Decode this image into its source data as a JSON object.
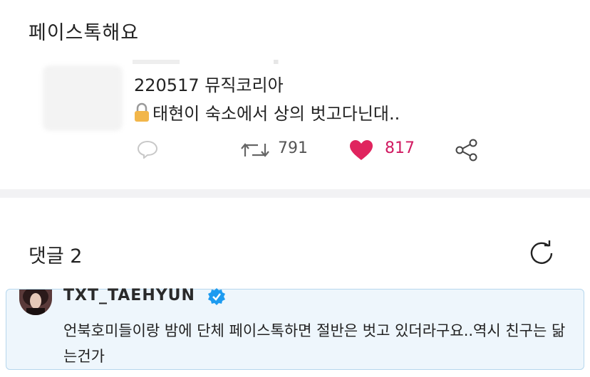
{
  "header": {
    "title": "페이스톡해요"
  },
  "tweet": {
    "line1": "220517 뮤직코리아",
    "line2": "태현이 숙소에서 상의 벗고다닌대..",
    "icons": {
      "lock": "lock-icon",
      "reply": "reply-icon",
      "retweet": "retweet-icon",
      "like": "heart-icon",
      "share": "share-icon"
    },
    "retweets": "791",
    "likes": "817",
    "colors": {
      "like": "#d11a61",
      "lock": "#f2b64a"
    }
  },
  "comments": {
    "title": "댓글 2",
    "refresh_icon": "refresh-icon",
    "items": [
      {
        "author": "TXT_TAEHYUN",
        "verified": true,
        "text": "언북호미들이랑 밤에 단체 페이스톡하면 절반은 벗고 있더라구요..역시 친구는 닮는건가"
      }
    ]
  },
  "colors": {
    "comment_bg": "#eef6fc",
    "comment_border": "#b6d7ee",
    "verified": "#1d9bf0"
  }
}
